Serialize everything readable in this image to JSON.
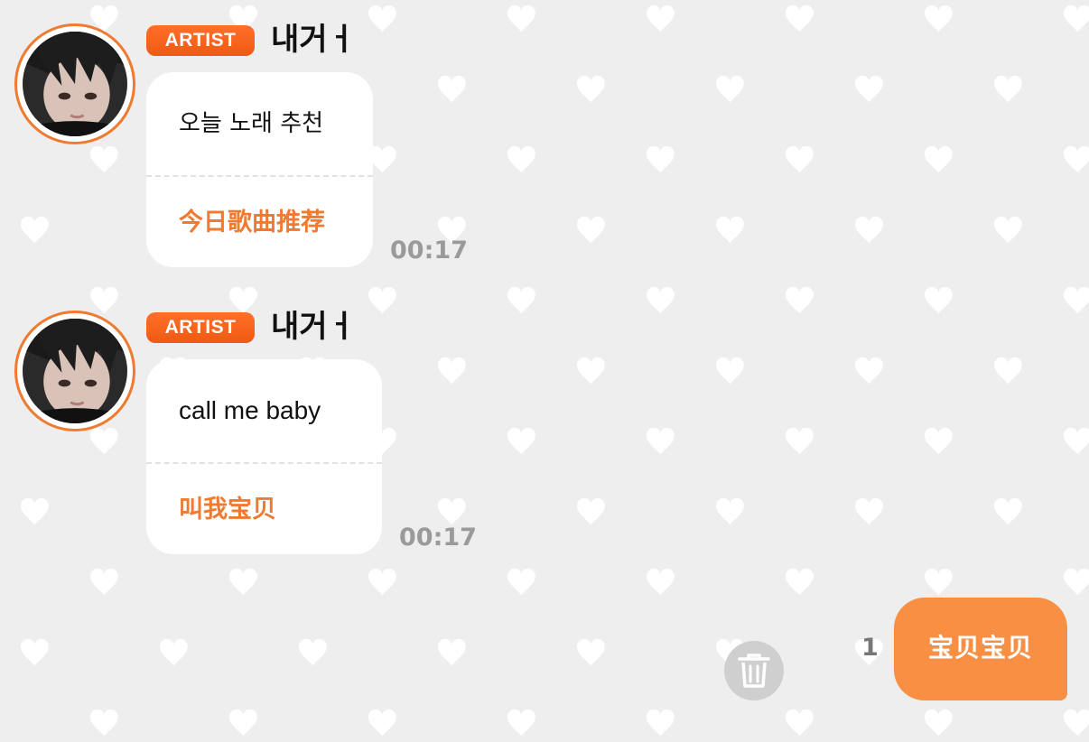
{
  "messages": [
    {
      "badge": "ARTIST",
      "sender": "내거ㅓ",
      "original": "오늘 노래 추천",
      "translation": "今日歌曲推荐",
      "time": "00:17"
    },
    {
      "badge": "ARTIST",
      "sender": "내거ㅓ",
      "original": "call me baby",
      "translation": "叫我宝贝",
      "time": "00:17"
    }
  ],
  "outgoing": {
    "text": "宝贝宝贝",
    "unread_count": "1"
  },
  "icons": {
    "delete": "trash-icon",
    "background": "heart-pattern"
  },
  "colors": {
    "accent": "#f07a30",
    "badge": "#f05a12",
    "outgoing_bubble": "#f98f42",
    "background": "#eeeeee",
    "timestamp": "#9a9a9a"
  }
}
